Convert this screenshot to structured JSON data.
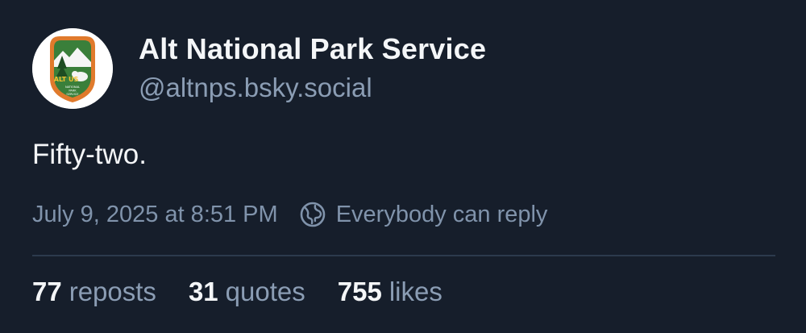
{
  "post": {
    "author": {
      "display_name": "Alt National Park Service",
      "handle": "@altnps.bsky.social",
      "avatar_text": "ALT US NATIONAL PARK SERVICE"
    },
    "text": "Fifty-two.",
    "timestamp": "July 9, 2025 at 8:51 PM",
    "reply_setting": "Everybody can reply",
    "stats": [
      {
        "count": "77",
        "label": "reposts"
      },
      {
        "count": "31",
        "label": "quotes"
      },
      {
        "count": "755",
        "label": "likes"
      }
    ]
  },
  "colors": {
    "background": "#161e2b",
    "primary_text": "#f4f6f8",
    "secondary_text": "#8b9db4",
    "divider": "#2c3a4d"
  }
}
